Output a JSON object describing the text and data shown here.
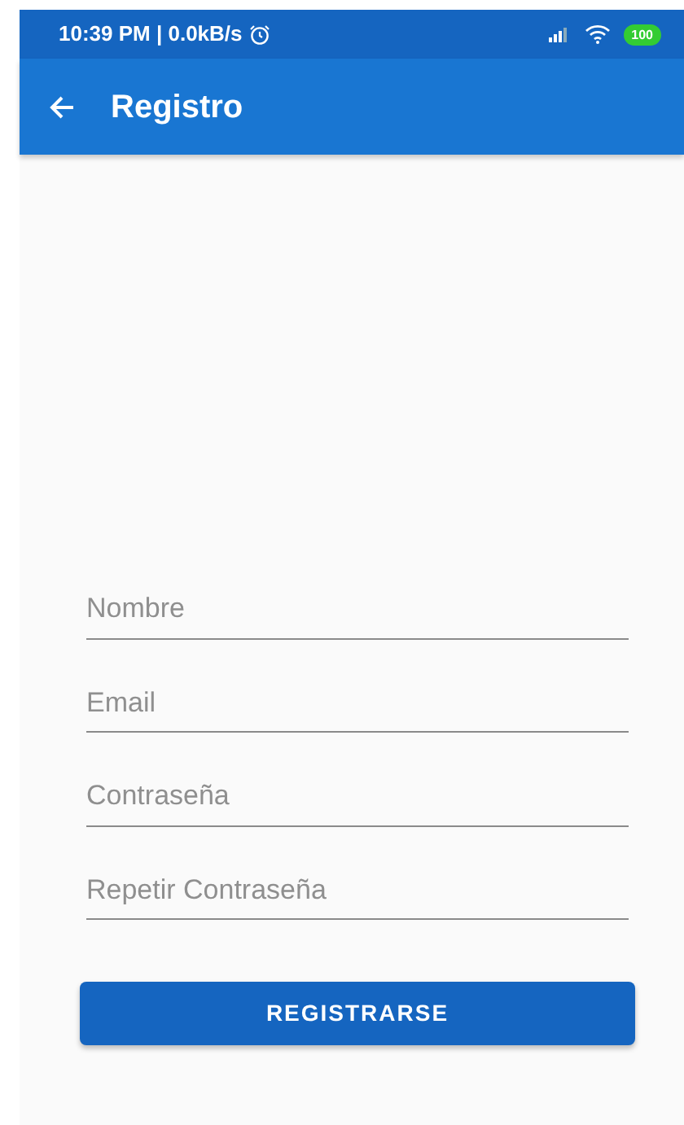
{
  "status_bar": {
    "left": "10:39 PM | 0.0kB/s",
    "battery": "100"
  },
  "app_bar": {
    "title": "Registro"
  },
  "fields": [
    {
      "placeholder": "Nombre"
    },
    {
      "placeholder": "Email"
    },
    {
      "placeholder": "Contraseña"
    },
    {
      "placeholder": "Repetir Contraseña"
    }
  ],
  "button": "REGISTRARSE"
}
